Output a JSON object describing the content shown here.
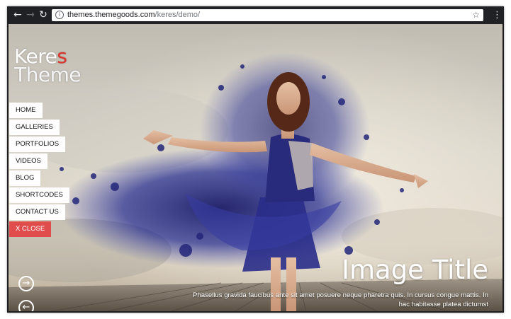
{
  "browser": {
    "back_glyph": "←",
    "forward_glyph": "→",
    "reload_glyph": "↻",
    "info_glyph": "i",
    "url_host": "themes.themegoods.com",
    "url_path": "/keres/demo/",
    "star_glyph": "☆",
    "menu_glyph": "⋮"
  },
  "site": {
    "logo_main": "Kere",
    "logo_accent": "s",
    "logo_sub": "Theme",
    "accent_color": "#d9342b"
  },
  "menu": {
    "items": [
      {
        "label": "HOME"
      },
      {
        "label": "GALLERIES"
      },
      {
        "label": "PORTFOLIOS"
      },
      {
        "label": "VIDEOS"
      },
      {
        "label": "BLOG"
      },
      {
        "label": "SHORTCODES"
      },
      {
        "label": "CONTACT US"
      }
    ],
    "close_label": "X CLOSE",
    "close_color": "#e04d4d"
  },
  "slider": {
    "next_glyph": "→",
    "prev_glyph": "←"
  },
  "caption": {
    "title": "Image Title",
    "text": "Phasellus gravida faucibus ante sit amet posuere neque pharetra quis. In cursus congue mattis. In hac habitasse platea dictumst"
  },
  "icons": [
    "back-arrow-icon",
    "forward-arrow-icon",
    "reload-icon",
    "info-icon",
    "star-icon",
    "more-menu-icon",
    "next-arrow-icon",
    "prev-arrow-icon"
  ]
}
